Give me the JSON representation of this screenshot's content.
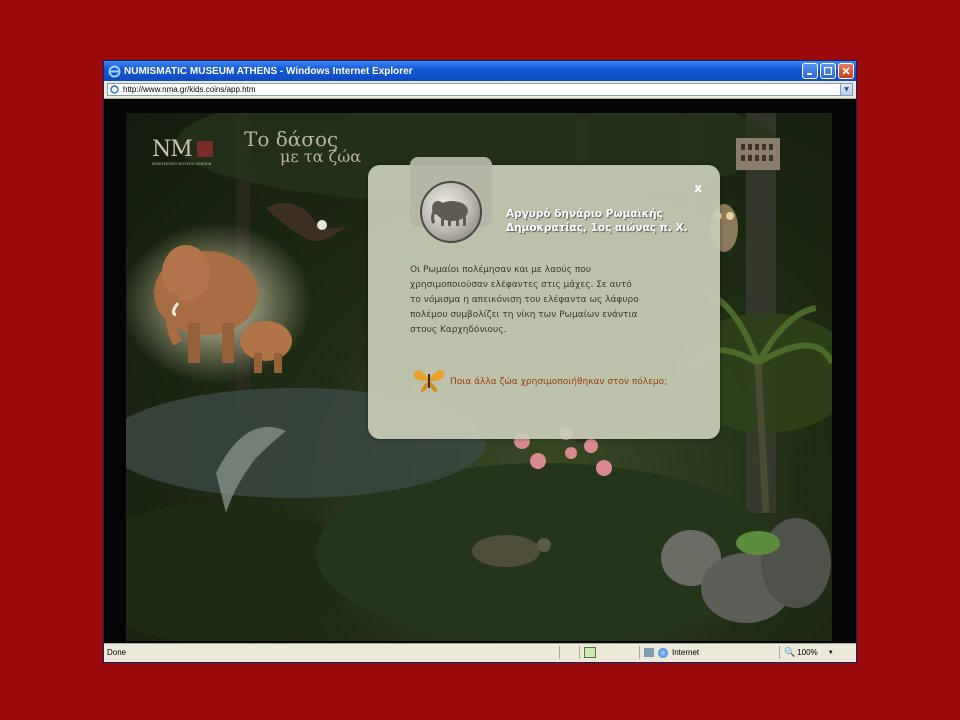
{
  "window": {
    "title": "NUMISMATIC MUSEUM ATHENS - Windows Internet Explorer",
    "address": "http://www.nma.gr/kids.coins/app.htm"
  },
  "site": {
    "logo_letters": "NM",
    "logo_subtitle": "ΝΟΜΙΣΜΑΤΙΚΟ ΜΟΥΣΕΙΟ ΑΘΗΝΩΝ",
    "heading_line1": "Το δάσος",
    "heading_line2": "με τα ζώα"
  },
  "popup": {
    "close": "x",
    "title_line1": "Αργυρό δηνάριο Ρωμαϊκής",
    "title_line2": "Δημοκρατίας, 1ος αιώνας π. Χ.",
    "body_lines": [
      "Οι Ρωμαίοι πολέμησαν και με λαούς που",
      "χρησιμοποιούσαν ελέφαντες στις μάχες. Σε αυτό",
      "το νόμισμα η απεικόνιση του ελέφαντα ως λάφυρο",
      "πολέμου συμβολίζει τη νίκη των Ρωμαίων ενάντια",
      "στους Καρχηδόνιους."
    ],
    "link": "Ποια άλλα ζώα χρησιμοποιήθηκαν στον πόλεμο;"
  },
  "statusbar": {
    "status": "Done",
    "zone": "Internet",
    "zoom": "100%"
  },
  "colors": {
    "background": "#9b0a0a",
    "titlebar": "#1558d6",
    "link": "#9b3d0e"
  }
}
